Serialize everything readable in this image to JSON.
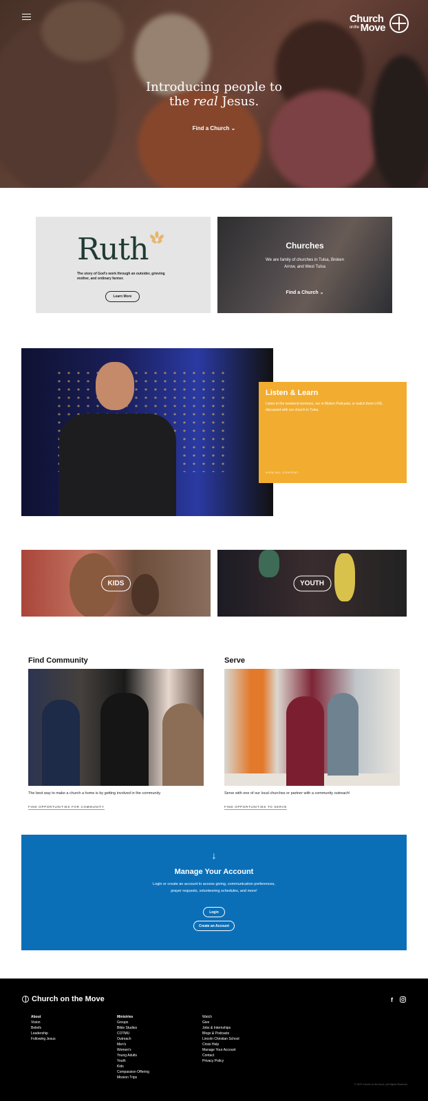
{
  "hero": {
    "title_line1": "Introducing people to",
    "title_pre": "the ",
    "title_em": "real",
    "title_post": " Jesus.",
    "cta": "Find a Church",
    "brand_line1": "Church",
    "brand_on": "on the",
    "brand_line2": "Move"
  },
  "ruth": {
    "logo": "Ruth",
    "desc": "The story of God's work through an outsider, grieving mother, and ordinary farmer.",
    "button": "Learn More"
  },
  "churches": {
    "title": "Churches",
    "desc": "We are family of churches in Tulsa, Broken Arrow, and West Tulsa",
    "cta": "Find a Church"
  },
  "listen": {
    "title": "Listen & Learn",
    "text": "Listen to the weekend sermons, our in Motion Podcasts, or watch them LIVE, discussed with our church in Tulsa.",
    "link": "VIEW ALL CONTENT"
  },
  "tiles": {
    "kids": "KIDS",
    "youth": "YOUTH"
  },
  "community": {
    "title": "Find Community",
    "text": "The best way to make a church a home is by getting involved in the community.",
    "link": "FIND OPPORTUNITIES FOR COMMUNITY"
  },
  "serve": {
    "title": "Serve",
    "text": "Serve with one of our local churches or partner with a community outreach!",
    "link": "FIND OPPORTUNITIES TO SERVE"
  },
  "account": {
    "title": "Manage Your Account",
    "text": "Login or create an account to access giving, communication preferences, prayer requests, volunteering schedules, and more!",
    "login": "Login",
    "create": "Create an Account"
  },
  "footer": {
    "brand": "Church on the Move",
    "col1": [
      "About",
      "Vision",
      "Beliefs",
      "Leadership",
      "Following Jesus"
    ],
    "col2": [
      "Ministries",
      "Groups",
      "Bible Studies",
      "COTMU",
      "Outreach",
      "Men's",
      "Women's",
      "Young Adults",
      "Youth",
      "Kids",
      "Compassion Offering",
      "Mission Trips"
    ],
    "col3": [
      "Watch",
      "Give",
      "Jobs & Internships",
      "Blogs & Podcasts",
      "Lincoln Christian School",
      "Crisis Help",
      "Manage Your Account",
      "Contact",
      "Privacy Policy"
    ],
    "copyright": "© 2023 Church on the Move | All Rights Reserved",
    "facebook": "f"
  },
  "colors": {
    "accent_blue": "#0b6fb8",
    "accent_gold": "#f2ad30"
  }
}
